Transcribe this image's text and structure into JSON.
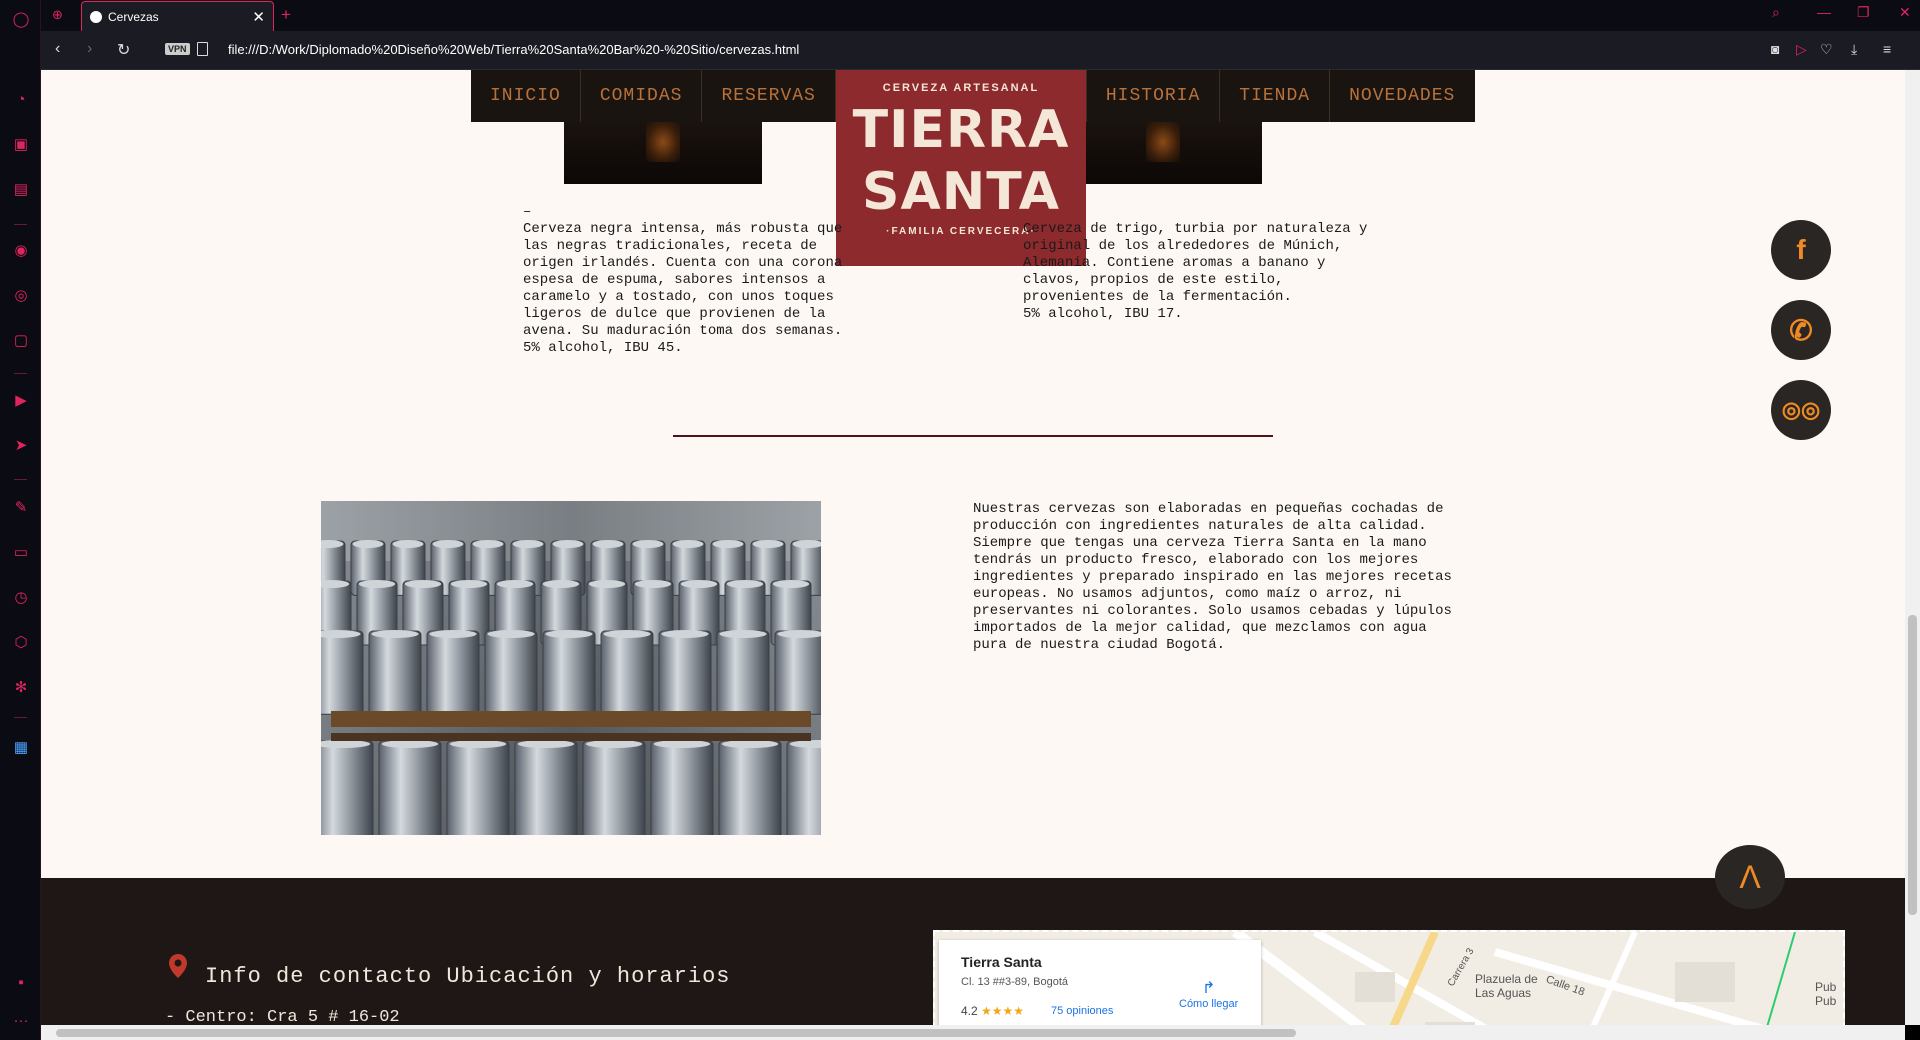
{
  "browser": {
    "tab_title": "Cervezas",
    "url": "file:///D:/Work/Diplomado%20Diseño%20Web/Tierra%20Santa%20Bar%20-%20Sitio/cervezas.html",
    "vpn_label": "VPN",
    "accent": "#e0245e"
  },
  "nav": {
    "left": [
      "INICIO",
      "COMIDAS",
      "RESERVAS"
    ],
    "right": [
      "HISTORIA",
      "TIENDA",
      "NOVEDADES"
    ]
  },
  "logo": {
    "top": "CERVEZA ARTESANAL",
    "line1": "TIERRA",
    "line2": "SANTA",
    "bottom": "·FAMILIA CERVECERA·"
  },
  "beers": {
    "left_dash": "–",
    "left_text": "Cerveza negra intensa, más robusta que\nlas negras tradicionales, receta de\norigen irlandés. Cuenta con una corona\nespesa de espuma, sabores intensos a\ncaramelo y a tostado, con unos toques\nligeros de dulce que provienen de la\navena. Su maduración toma dos semanas.\n5% alcohol, IBU 45.",
    "right_text": "Cerveza de trigo, turbia por naturaleza y\noriginal de los alrededores de Múnich,\nAlemania. Contiene aromas a banano y\nclavos, propios de este estilo,\nprovenientes de la fermentación.\n5% alcohol, IBU 17."
  },
  "about": {
    "text": "Nuestras cervezas son elaboradas en pequeñas cochadas de\nproducción con ingredientes naturales de alta calidad.\nSiempre que tengas una cerveza Tierra Santa en la mano\ntendrás un producto fresco, elaborado con los mejores\ningredientes y preparado inspirado en las mejores recetas\neuropeas. No usamos adjuntos, como maíz o arroz, ni\npreservantes ni colorantes. Solo usamos cebadas y lúpulos\nimportados de la mejor calidad, que mezclamos con agua\npura de nuestra ciudad Bogotá."
  },
  "social": [
    "facebook-icon",
    "phone-icon",
    "tripadvisor-icon"
  ],
  "to_top": "Λ",
  "footer": {
    "title": "Info de contacto Ubicación y horarios",
    "address": "- Centro: Cra 5 # 16-02"
  },
  "map": {
    "place_name": "Tierra Santa",
    "place_address": "Cl. 13 ##3-89, Bogotá",
    "rating": "4.2",
    "stars": "★★★★",
    "reviews": "75 opiniones",
    "directions": "Cómo llegar",
    "labels": [
      "Plazuela de\nLas Aguas",
      "Carrera 3",
      "Calle 18",
      "Pub\nPub"
    ]
  }
}
